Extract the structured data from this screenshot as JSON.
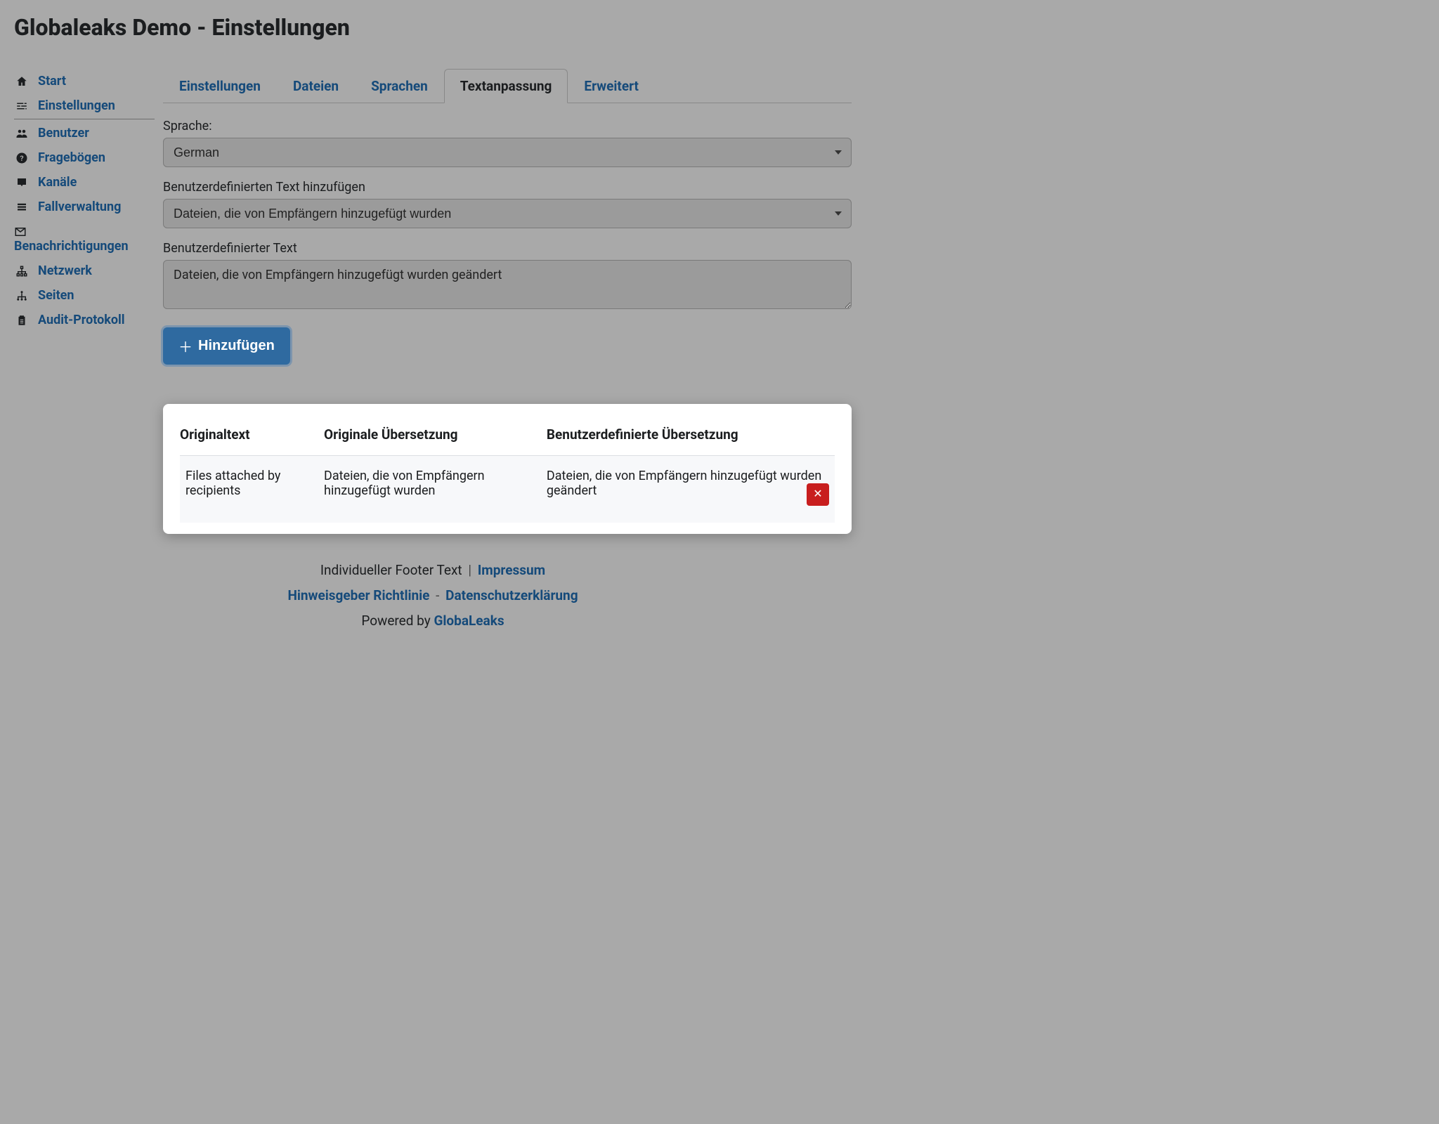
{
  "header": {
    "title": "Globaleaks Demo - Einstellungen"
  },
  "sidebar": {
    "items": [
      {
        "icon": "home",
        "label": "Start"
      },
      {
        "icon": "sliders",
        "label": "Einstellungen",
        "active": true
      },
      {
        "icon": "users",
        "label": "Benutzer"
      },
      {
        "icon": "question",
        "label": "Fragebögen"
      },
      {
        "icon": "inbox",
        "label": "Kanäle"
      },
      {
        "icon": "list",
        "label": "Fallverwaltung"
      },
      {
        "icon": "envelope",
        "label": "Benachrichtigungen"
      },
      {
        "icon": "network",
        "label": "Netzwerk"
      },
      {
        "icon": "sitemap",
        "label": "Seiten"
      },
      {
        "icon": "clipboard",
        "label": "Audit-Protokoll"
      }
    ]
  },
  "tabs": [
    {
      "label": "Einstellungen"
    },
    {
      "label": "Dateien"
    },
    {
      "label": "Sprachen"
    },
    {
      "label": "Textanpassung",
      "active": true
    },
    {
      "label": "Erweitert"
    }
  ],
  "form": {
    "language_label": "Sprache:",
    "language_value": "German",
    "add_text_label": "Benutzerdefinierten Text hinzufügen",
    "add_text_value": "Dateien, die von Empfängern hinzugefügt wurden",
    "custom_text_label": "Benutzerdefinierter Text",
    "custom_text_value": "Dateien, die von Empfängern hinzugefügt wurden geändert",
    "add_button": "Hinzufügen"
  },
  "table": {
    "headers": [
      "Originaltext",
      "Originale Übersetzung",
      "Benutzerdefinierte Übersetzung"
    ],
    "rows": [
      {
        "original": "Files attached by recipients",
        "translation": "Dateien, die von Empfängern hinzugefügt wurden",
        "custom": "Dateien, die von Empfängern hinzugefügt wurden geändert"
      }
    ]
  },
  "footer": {
    "custom_text": "Individueller Footer Text",
    "impressum": "Impressum",
    "policy": "Hinweisgeber Richtlinie",
    "privacy": "Datenschutzerklärung",
    "powered": "Powered by ",
    "brand": "GlobaLeaks"
  }
}
